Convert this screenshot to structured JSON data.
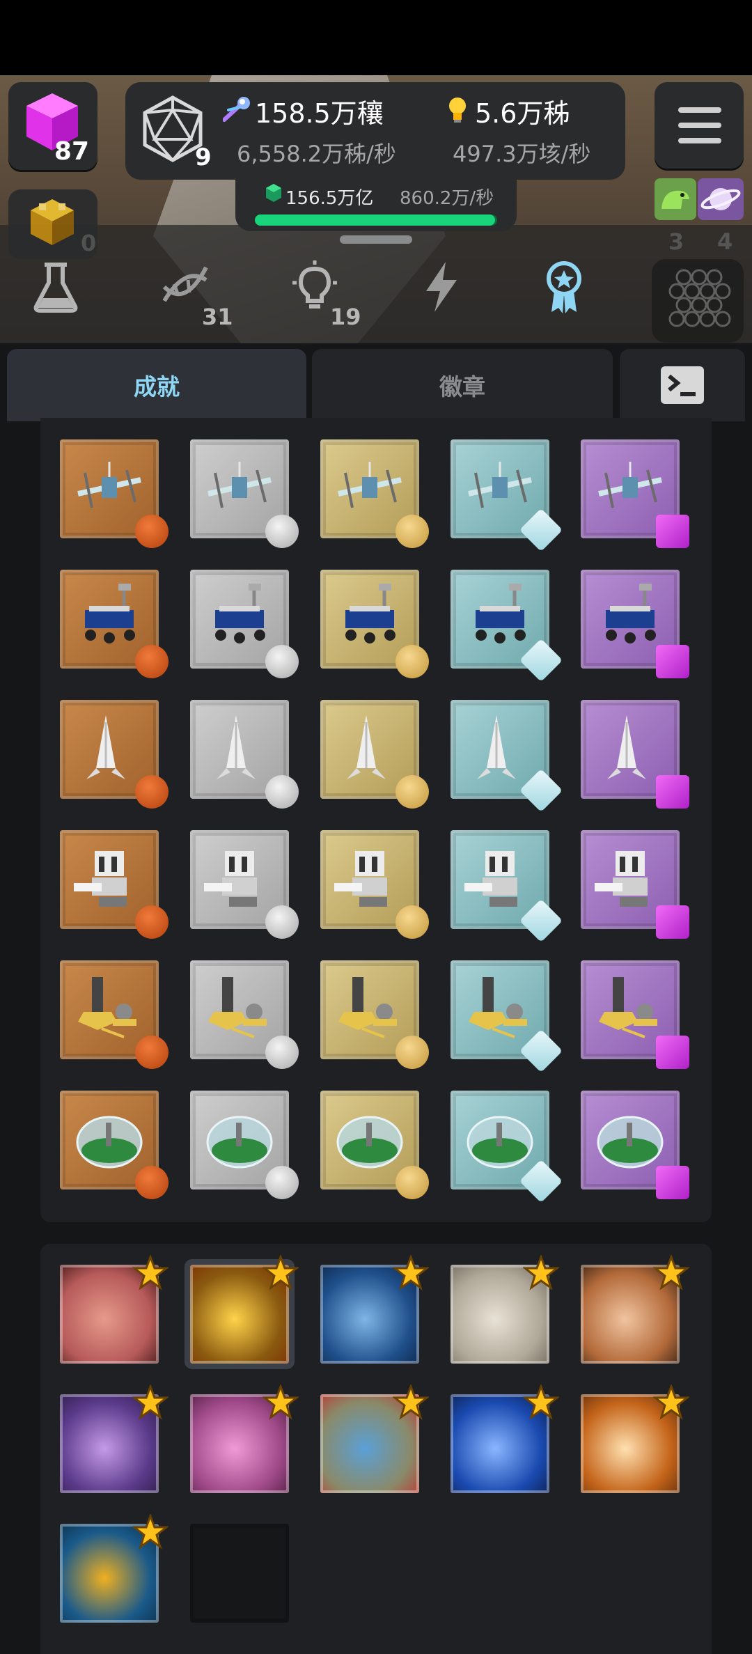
{
  "header": {
    "gems_count": "87",
    "dice_level": "9",
    "resource1_value": "158.5万穰",
    "resource1_rate": "6,558.2万秭/秒",
    "resource2_value": "5.6万秭",
    "resource2_rate": "497.3万垓/秒",
    "sub_value": "156.5万亿",
    "sub_rate": "860.2万/秒",
    "sub_progress": 0.99,
    "box_count": "0",
    "creature_count": "3",
    "planet_count": "4"
  },
  "science_tabs": [
    {
      "icon": "flask-icon",
      "count": ""
    },
    {
      "icon": "dna-icon",
      "count": "31"
    },
    {
      "icon": "lightbulb-icon",
      "count": "19"
    },
    {
      "icon": "lightning-icon",
      "count": ""
    },
    {
      "icon": "award-icon",
      "count": ""
    }
  ],
  "tabs": {
    "achievements": "成就",
    "badges": "徽章"
  },
  "achievement_rows": [
    {
      "object": "satellite"
    },
    {
      "object": "rover"
    },
    {
      "object": "rocket"
    },
    {
      "object": "robot"
    },
    {
      "object": "base"
    },
    {
      "object": "dome"
    }
  ],
  "achievement_tiers": [
    "bronze",
    "silver",
    "gold",
    "diamond",
    "purple-gem"
  ],
  "badges": [
    {
      "name": "shark-badge"
    },
    {
      "name": "crown-badge"
    },
    {
      "name": "whale-badge"
    },
    {
      "name": "darwin-badge"
    },
    {
      "name": "dog-badge"
    },
    {
      "name": "dragon-badge"
    },
    {
      "name": "dolphin-badge"
    },
    {
      "name": "bird-badge"
    },
    {
      "name": "yeti-badge"
    },
    {
      "name": "fox-badge"
    },
    {
      "name": "slug-badge"
    }
  ],
  "colors": {
    "accent_tab": "#8fd6f4",
    "progress_fill": "#19d47a",
    "panel": "#2a2b2d"
  }
}
